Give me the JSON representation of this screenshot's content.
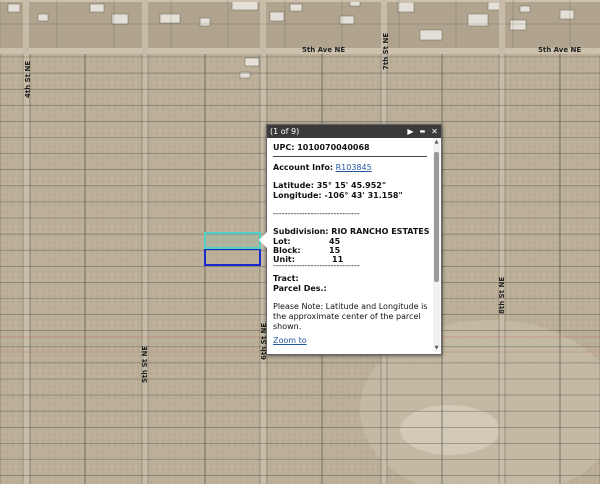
{
  "road_labels": {
    "ave_5th_left": "5th Ave NE",
    "ave_5th_right": "5th Ave NE",
    "st_4th": "4th St NE",
    "st_5th": "5th St NE",
    "st_6th_mid": "6th St NE",
    "st_7th": "7th St NE",
    "st_8th": "8th St NE"
  },
  "popup": {
    "title": "(1 of 9)",
    "buttons": {
      "next": "▶",
      "minimize": "▬",
      "close": "✕"
    },
    "upc": "UPC: 1010070040068",
    "account_label": "Account Info:",
    "account_link": "R103845",
    "latitude": "Latitude: 35° 15' 45.952\"",
    "longitude": "Longitude: -106° 43' 31.158\"",
    "divider": "------------------------------",
    "subdivision": "Subdivision: RIO RANCHO ESTATES",
    "lot_label": "Lot:",
    "lot_value": "45",
    "block_label": "Block:",
    "block_value": "15",
    "unit_label": "Unit:",
    "unit_value": "11",
    "tract": "Tract:",
    "parcel_des": "Parcel Des.:",
    "note": "Please Note: Latitude and Longitude is the approximate center of the parcel shown.",
    "zoom_link": "Zoom to"
  },
  "colors": {
    "selected_parcel_outline": "#4fd1c5",
    "adjacent_parcel_outline": "#1a2acc",
    "parcel_line": "#3c3c3c",
    "popup_titlebar": "#3a3a3a",
    "link": "#2357a0"
  }
}
